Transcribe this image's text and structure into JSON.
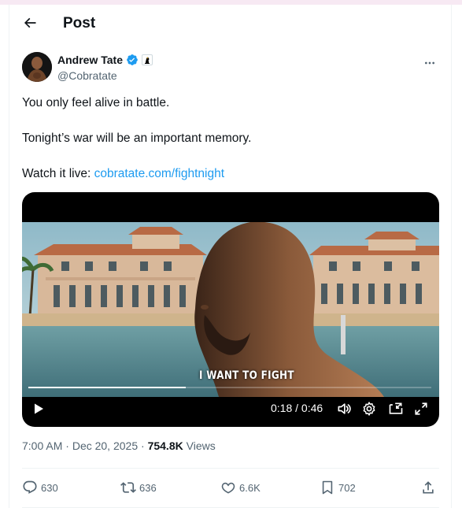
{
  "header": {
    "title": "Post"
  },
  "author": {
    "display_name": "Andrew Tate",
    "handle": "@Cobratate"
  },
  "tweet": {
    "line1": "You only feel alive in battle.",
    "line2": "Tonight’s war will be an important memory.",
    "line3_prefix": "Watch it live: ",
    "link_text": "cobratate.com/fightnight"
  },
  "video": {
    "caption": "I WANT TO FIGHT",
    "time": "0:18 / 0:46",
    "progress": 0.39
  },
  "meta": {
    "time": "7:00 AM",
    "date": "Dec 20, 2025",
    "views_count": "754.8K",
    "views_label": "Views"
  },
  "actions": {
    "replies": "630",
    "reposts": "636",
    "likes": "6.6K",
    "bookmarks": "702"
  },
  "colors": {
    "accent": "#1d9bf0",
    "text": "#0f1419",
    "muted": "#536471"
  }
}
